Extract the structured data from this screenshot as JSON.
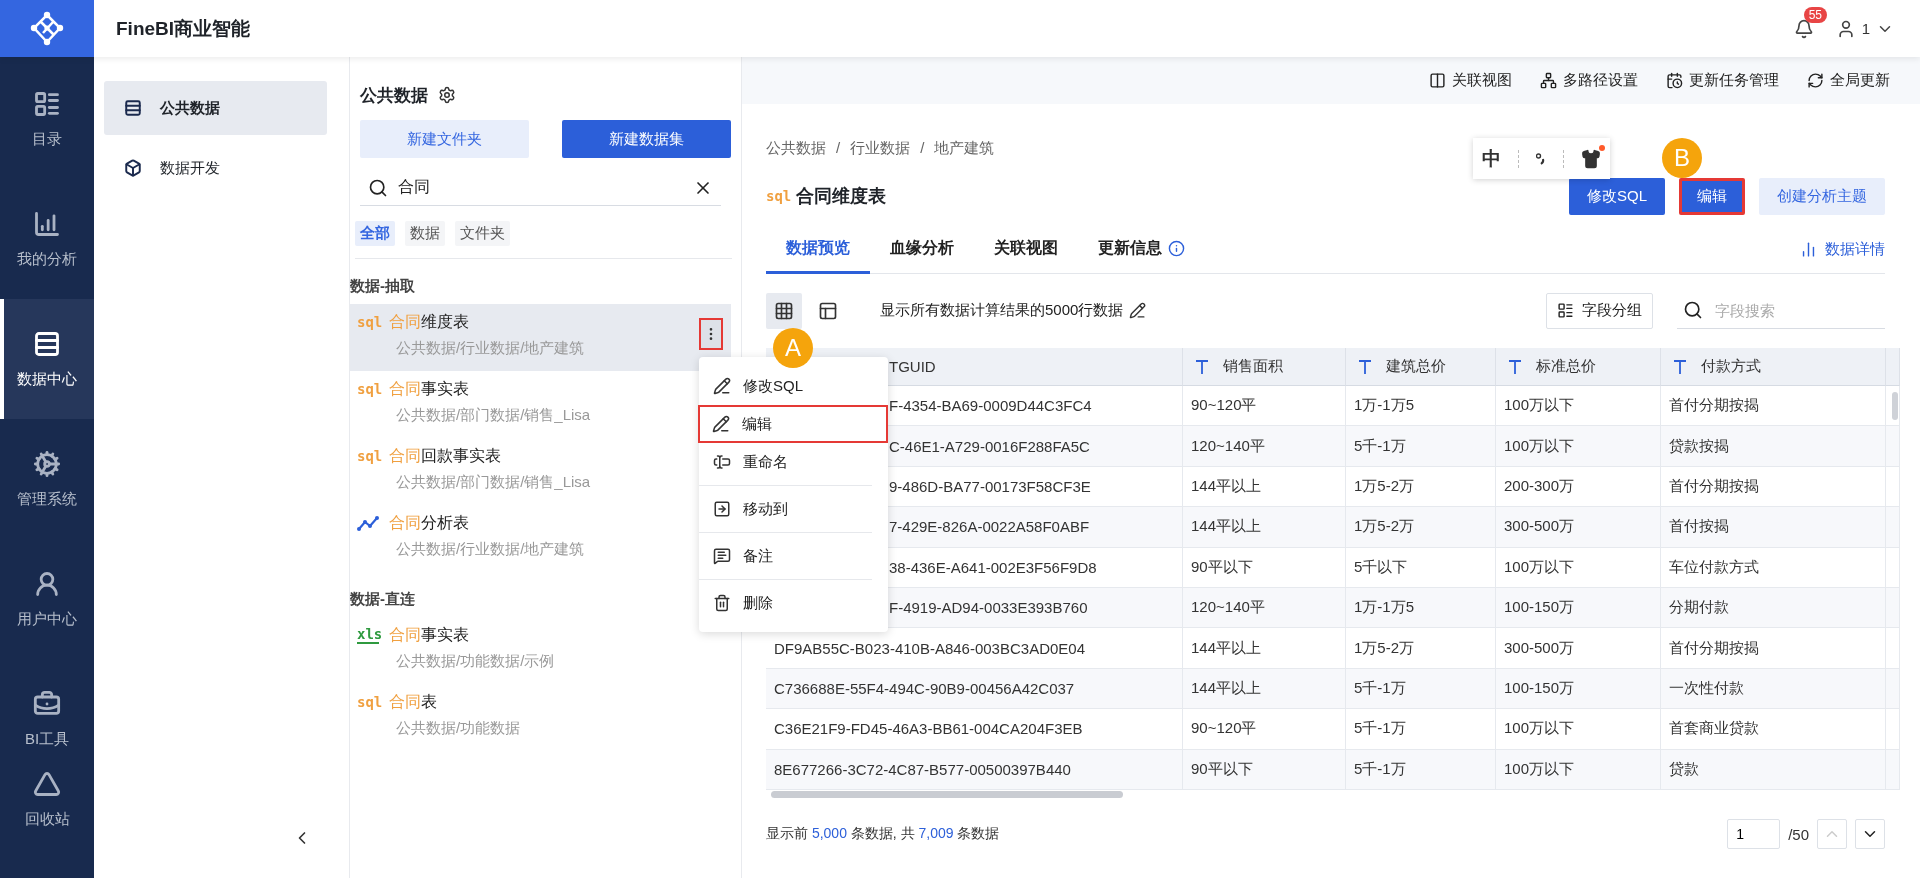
{
  "app": {
    "title": "FineBI商业智能"
  },
  "header": {
    "notifications": "55",
    "user": "1"
  },
  "nav": [
    {
      "label": "目录",
      "kind": "catalog",
      "selected": false
    },
    {
      "label": "我的分析",
      "kind": "analysis",
      "selected": false
    },
    {
      "label": "数据中心",
      "kind": "datacenter",
      "selected": true
    },
    {
      "label": "管理系统",
      "kind": "admin",
      "selected": false
    },
    {
      "label": "用户中心",
      "kind": "users",
      "selected": false
    },
    {
      "label": "BI工具",
      "kind": "tools",
      "selected": false
    },
    {
      "label": "回收站",
      "kind": "recycle",
      "selected": false
    }
  ],
  "subnav": [
    {
      "label": "公共数据",
      "kind": "public",
      "selected": true
    },
    {
      "label": "数据开发",
      "kind": "develop",
      "selected": false
    }
  ],
  "panel": {
    "title": "公共数据",
    "buttons": [
      {
        "label": "新建文件夹",
        "kind": "secondary"
      },
      {
        "label": "新建数据集",
        "kind": "primary"
      }
    ],
    "search": {
      "value": "合同"
    },
    "filters": [
      {
        "label": "全部",
        "selected": true
      },
      {
        "label": "数据",
        "selected": false
      },
      {
        "label": "文件夹",
        "selected": false
      }
    ],
    "groups": [
      {
        "title": "数据-抽取",
        "items": [
          {
            "kind": "sql",
            "tag": "sql",
            "match": "合同",
            "rest": "维度表",
            "path": "公共数据/行业数据/地产建筑",
            "selected": true,
            "more_highlighted": true
          },
          {
            "kind": "sql",
            "tag": "sql",
            "match": "合同",
            "rest": "事实表",
            "path": "公共数据/部门数据/销售_Lisa",
            "selected": false,
            "more_highlighted": false
          },
          {
            "kind": "sql",
            "tag": "sql",
            "match": "合同",
            "rest": "回款事实表",
            "path": "公共数据/部门数据/销售_Lisa",
            "selected": false,
            "more_highlighted": false
          },
          {
            "kind": "analysis",
            "match": "合同",
            "rest": "分析表",
            "path": "公共数据/行业数据/地产建筑",
            "selected": false,
            "more_highlighted": false
          }
        ]
      },
      {
        "title": "数据-直连",
        "items": [
          {
            "kind": "xls",
            "tag": "xls",
            "match": "合同",
            "rest": "事实表",
            "path": "公共数据/功能数据/示例",
            "selected": false,
            "more_highlighted": false
          },
          {
            "kind": "sql",
            "tag": "sql",
            "match": "合同",
            "rest": "表",
            "path": "公共数据/功能数据",
            "selected": false,
            "more_highlighted": false
          }
        ]
      }
    ]
  },
  "context_menu": {
    "sections": [
      [
        {
          "label": "修改SQL",
          "kind": "edit",
          "highlighted": false
        },
        {
          "label": "编辑",
          "kind": "edit",
          "highlighted": true
        },
        {
          "label": "重命名",
          "kind": "rename",
          "highlighted": false
        }
      ],
      [
        {
          "label": "移动到",
          "kind": "move",
          "highlighted": false
        }
      ],
      [
        {
          "label": "备注",
          "kind": "note",
          "highlighted": false
        }
      ],
      [
        {
          "label": "删除",
          "kind": "delete",
          "highlighted": false
        }
      ]
    ]
  },
  "callouts": [
    {
      "label": "A"
    },
    {
      "label": "B"
    }
  ],
  "toolbar": [
    {
      "label": "关联视图",
      "kind": "relation"
    },
    {
      "label": "多路径设置",
      "kind": "paths"
    },
    {
      "label": "更新任务管理",
      "kind": "tasks"
    },
    {
      "label": "全局更新",
      "kind": "refresh"
    }
  ],
  "breadcrumb": {
    "separator": "/",
    "items": [
      "公共数据",
      "行业数据",
      "地产建筑"
    ]
  },
  "ime": {
    "mode": "中"
  },
  "dataset": {
    "tag": "sql",
    "title": "合同维度表",
    "actions": [
      {
        "label": "修改SQL",
        "kind": "primary",
        "highlighted": false
      },
      {
        "label": "编辑",
        "kind": "primary",
        "highlighted": true
      },
      {
        "label": "创建分析主题",
        "kind": "secondary",
        "highlighted": false
      }
    ]
  },
  "tabs": [
    {
      "label": "数据预览",
      "selected": true,
      "info": false
    },
    {
      "label": "血缘分析",
      "selected": false,
      "info": false
    },
    {
      "label": "关联视图",
      "selected": false,
      "info": false
    },
    {
      "label": "更新信息",
      "selected": false,
      "info": true
    }
  ],
  "details_link": "数据详情",
  "preview": {
    "views": [
      {
        "kind": "grid",
        "selected": true
      },
      {
        "kind": "layout",
        "selected": false
      }
    ],
    "caption": "显示所有数据计算结果的5000行数据",
    "group_button": "字段分组",
    "search": {
      "placeholder": "字段搜索"
    }
  },
  "table": {
    "columns": [
      {
        "label": "TGUID",
        "covered": true
      },
      {
        "label": "销售面积",
        "covered": false
      },
      {
        "label": "建筑总价",
        "covered": false
      },
      {
        "label": "标准总价",
        "covered": false
      },
      {
        "label": "付款方式",
        "covered": false
      }
    ],
    "rows": [
      {
        "covered": true,
        "cells": [
          "F-4354-BA69-0009D44C3FC4",
          "90~120平",
          "1万-1万5",
          "100万以下",
          "首付分期按揭"
        ]
      },
      {
        "covered": true,
        "cells": [
          "C-46E1-A729-0016F288FA5C",
          "120~140平",
          "5千-1万",
          "100万以下",
          "贷款按揭"
        ]
      },
      {
        "covered": true,
        "cells": [
          "9-486D-BA77-00173F58CF3E",
          "144平以上",
          "1万5-2万",
          "200-300万",
          "首付分期按揭"
        ]
      },
      {
        "covered": true,
        "cells": [
          "7-429E-826A-0022A58F0ABF",
          "144平以上",
          "1万5-2万",
          "300-500万",
          "首付按揭"
        ]
      },
      {
        "covered": true,
        "cells": [
          "38-436E-A641-002E3F56F9D8",
          "90平以下",
          "5千以下",
          "100万以下",
          "车位付款方式"
        ]
      },
      {
        "covered": true,
        "cells": [
          "F-4919-AD94-0033E393B760",
          "120~140平",
          "1万-1万5",
          "100-150万",
          "分期付款"
        ]
      },
      {
        "covered": false,
        "cells": [
          "DF9AB55C-B023-410B-A846-003BC3AD0E04",
          "144平以上",
          "1万5-2万",
          "300-500万",
          "首付分期按揭"
        ]
      },
      {
        "covered": false,
        "cells": [
          "C736688E-55F4-494C-90B9-00456A42C037",
          "144平以上",
          "5千-1万",
          "100-150万",
          "一次性付款"
        ]
      },
      {
        "covered": false,
        "cells": [
          "C36E21F9-FD45-46A3-BB61-004CA204F3EB",
          "90~120平",
          "5千-1万",
          "100万以下",
          "首套商业贷款"
        ]
      },
      {
        "covered": false,
        "cells": [
          "8E677266-3C72-4C87-B577-00500397B440",
          "90平以下",
          "5千-1万",
          "100万以下",
          "贷款"
        ]
      }
    ]
  },
  "footer": {
    "summary": [
      {
        "text": "显示前 ",
        "kind": "plain"
      },
      {
        "text": "5,000",
        "kind": "number"
      },
      {
        "text": " 条数据, 共 ",
        "kind": "plain"
      },
      {
        "text": "7,009",
        "kind": "number"
      },
      {
        "text": " 条数据",
        "kind": "plain"
      }
    ]
  },
  "pagination": {
    "page": "1",
    "total": "/50"
  }
}
